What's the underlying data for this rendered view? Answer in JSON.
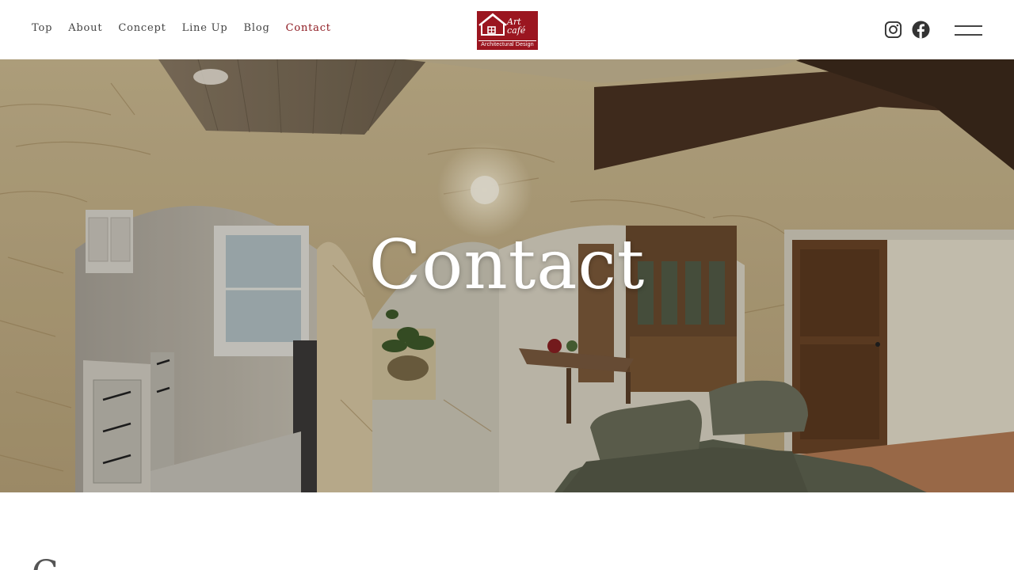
{
  "header": {
    "nav": [
      {
        "label": "Top",
        "active": false
      },
      {
        "label": "About",
        "active": false
      },
      {
        "label": "Concept",
        "active": false
      },
      {
        "label": "Line Up",
        "active": false
      },
      {
        "label": "Blog",
        "active": false
      },
      {
        "label": "Contact",
        "active": true
      }
    ],
    "logo": {
      "text_top": "Art café",
      "text_strap": "Architectural Design",
      "color": "#9b1620"
    },
    "social": [
      {
        "icon": "instagram-icon"
      },
      {
        "icon": "facebook-icon"
      }
    ],
    "menu_icon": "hamburger-icon"
  },
  "hero": {
    "title": "Contact"
  },
  "section": {
    "heading_peek": "C"
  },
  "colors": {
    "accent": "#8e1b22",
    "nav_text": "#444444",
    "hero_text": "#ffffff"
  }
}
